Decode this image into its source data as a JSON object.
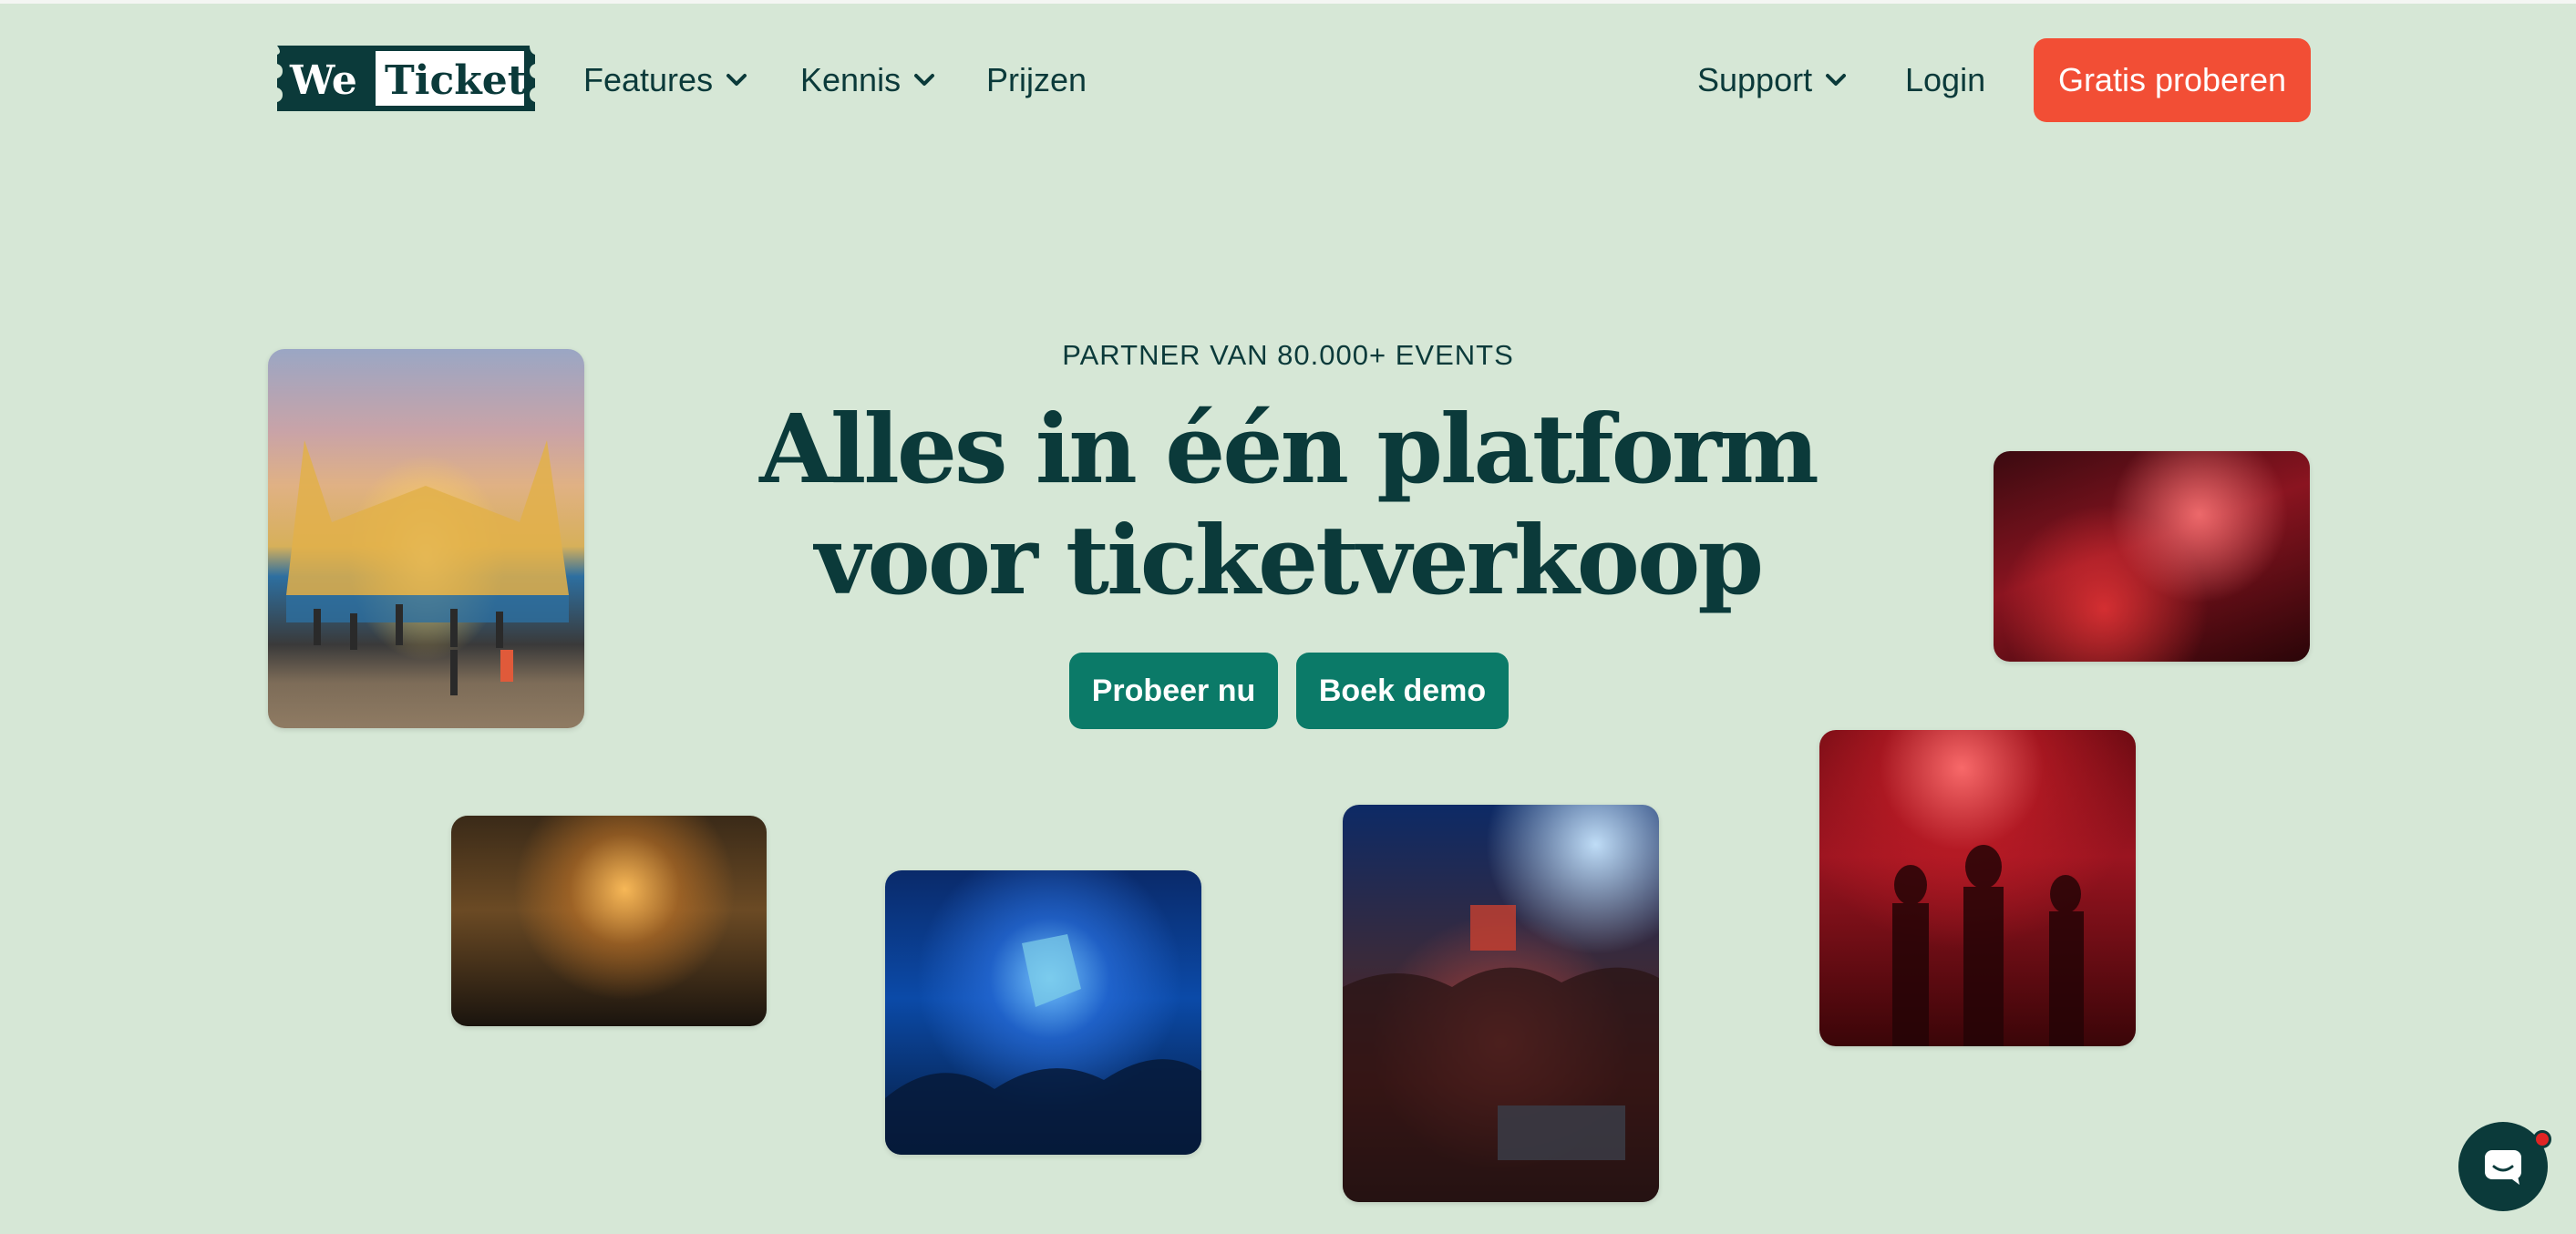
{
  "brand": {
    "logo_text_left": "We",
    "logo_text_right": "Ticket"
  },
  "nav": {
    "features": "Features",
    "kennis": "Kennis",
    "prijzen": "Prijzen",
    "support": "Support",
    "login": "Login",
    "cta": "Gratis proberen"
  },
  "hero": {
    "eyebrow": "PARTNER VAN 80.000+ EVENTS",
    "headline_line1": "Alles in één platform",
    "headline_line2": "voor ticketverkoop",
    "primary_button": "Probeer nu",
    "secondary_button": "Boek demo"
  },
  "colors": {
    "background": "#d6e7d6",
    "text_dark": "#0b3a3a",
    "cta_orange": "#f24e35",
    "button_teal": "#0b7a68"
  },
  "icons": {
    "nav_chevron": "chevron-down-icon",
    "chat": "chat-bubble-icon"
  }
}
